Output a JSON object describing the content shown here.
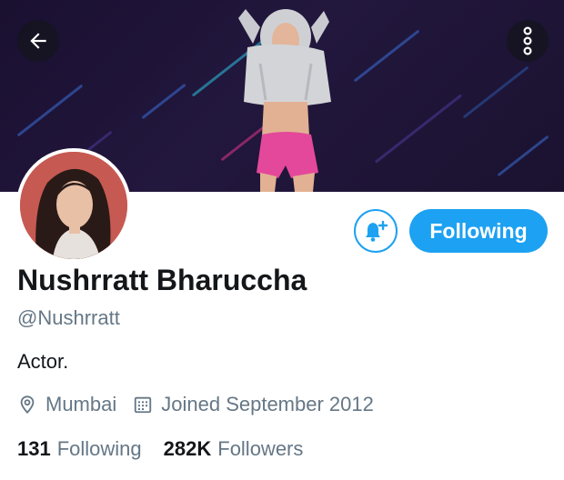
{
  "header": {
    "back_icon": "arrow-left-icon",
    "more_icon": "more-vertical-icon"
  },
  "profile": {
    "name": "Nushrratt Bharuccha",
    "handle": "@Nushrratt",
    "bio": "Actor.",
    "location": "Mumbai",
    "location_icon": "location-pin-icon",
    "joined": "Joined September 2012",
    "joined_icon": "calendar-icon"
  },
  "actions": {
    "notify_icon": "bell-plus-icon",
    "follow_label": "Following"
  },
  "stats": {
    "following_count": "131",
    "following_label": "Following",
    "followers_count": "282K",
    "followers_label": "Followers"
  },
  "colors": {
    "accent": "#1da1f2",
    "text_primary": "#14171a",
    "text_secondary": "#657786",
    "banner_bg": "#1f1536"
  }
}
